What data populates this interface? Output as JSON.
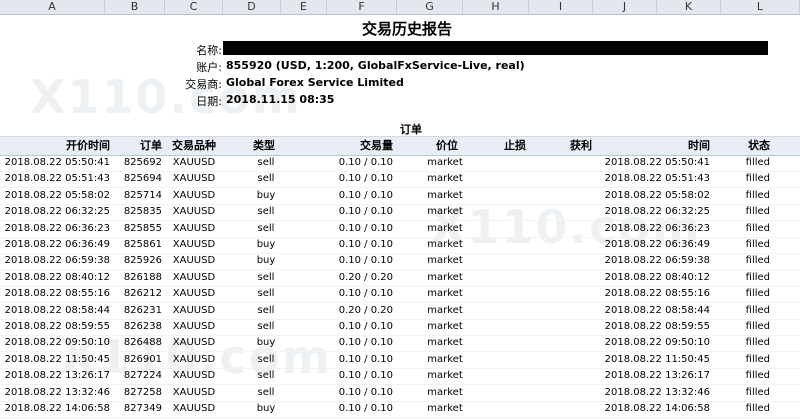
{
  "columns": [
    "A",
    "B",
    "C",
    "D",
    "E",
    "F",
    "G",
    "H",
    "I",
    "J",
    "K",
    "L"
  ],
  "report_title": "交易历史报告",
  "info": {
    "name_label": "名称:",
    "account_label": "账户:",
    "account_value": "855920 (USD, 1:200, GlobalFxService-Live, real)",
    "broker_label": "交易商:",
    "broker_value": "Global Forex Service Limited",
    "date_label": "日期:",
    "date_value": "2018.11.15 08:35"
  },
  "section_title": "订单",
  "table": {
    "headers": {
      "open_time": "开价时间",
      "order": "订单",
      "symbol": "交易品种",
      "type": "类型",
      "volume": "交易量",
      "price": "价位",
      "sl": "止损",
      "tp": "获利",
      "time": "时间",
      "state": "状态"
    },
    "rows": [
      {
        "open_time": "2018.08.22 05:50:41",
        "order": "825692",
        "symbol": "XAUUSD",
        "type": "sell",
        "volume": "0.10 / 0.10",
        "price": "market",
        "time": "2018.08.22 05:50:41",
        "state": "filled"
      },
      {
        "open_time": "2018.08.22 05:51:43",
        "order": "825694",
        "symbol": "XAUUSD",
        "type": "sell",
        "volume": "0.10 / 0.10",
        "price": "market",
        "time": "2018.08.22 05:51:43",
        "state": "filled"
      },
      {
        "open_time": "2018.08.22 05:58:02",
        "order": "825714",
        "symbol": "XAUUSD",
        "type": "buy",
        "volume": "0.10 / 0.10",
        "price": "market",
        "time": "2018.08.22 05:58:02",
        "state": "filled"
      },
      {
        "open_time": "2018.08.22 06:32:25",
        "order": "825835",
        "symbol": "XAUUSD",
        "type": "sell",
        "volume": "0.10 / 0.10",
        "price": "market",
        "time": "2018.08.22 06:32:25",
        "state": "filled"
      },
      {
        "open_time": "2018.08.22 06:36:23",
        "order": "825855",
        "symbol": "XAUUSD",
        "type": "sell",
        "volume": "0.10 / 0.10",
        "price": "market",
        "time": "2018.08.22 06:36:23",
        "state": "filled"
      },
      {
        "open_time": "2018.08.22 06:36:49",
        "order": "825861",
        "symbol": "XAUUSD",
        "type": "buy",
        "volume": "0.10 / 0.10",
        "price": "market",
        "time": "2018.08.22 06:36:49",
        "state": "filled"
      },
      {
        "open_time": "2018.08.22 06:59:38",
        "order": "825926",
        "symbol": "XAUUSD",
        "type": "buy",
        "volume": "0.10 / 0.10",
        "price": "market",
        "time": "2018.08.22 06:59:38",
        "state": "filled"
      },
      {
        "open_time": "2018.08.22 08:40:12",
        "order": "826188",
        "symbol": "XAUUSD",
        "type": "sell",
        "volume": "0.20 / 0.20",
        "price": "market",
        "time": "2018.08.22 08:40:12",
        "state": "filled"
      },
      {
        "open_time": "2018.08.22 08:55:16",
        "order": "826212",
        "symbol": "XAUUSD",
        "type": "sell",
        "volume": "0.10 / 0.10",
        "price": "market",
        "time": "2018.08.22 08:55:16",
        "state": "filled"
      },
      {
        "open_time": "2018.08.22 08:58:44",
        "order": "826231",
        "symbol": "XAUUSD",
        "type": "sell",
        "volume": "0.20 / 0.20",
        "price": "market",
        "time": "2018.08.22 08:58:44",
        "state": "filled"
      },
      {
        "open_time": "2018.08.22 08:59:55",
        "order": "826238",
        "symbol": "XAUUSD",
        "type": "sell",
        "volume": "0.10 / 0.10",
        "price": "market",
        "time": "2018.08.22 08:59:55",
        "state": "filled"
      },
      {
        "open_time": "2018.08.22 09:50:10",
        "order": "826488",
        "symbol": "XAUUSD",
        "type": "buy",
        "volume": "0.10 / 0.10",
        "price": "market",
        "time": "2018.08.22 09:50:10",
        "state": "filled"
      },
      {
        "open_time": "2018.08.22 11:50:45",
        "order": "826901",
        "symbol": "XAUUSD",
        "type": "sell",
        "volume": "0.10 / 0.10",
        "price": "market",
        "time": "2018.08.22 11:50:45",
        "state": "filled"
      },
      {
        "open_time": "2018.08.22 13:26:17",
        "order": "827224",
        "symbol": "XAUUSD",
        "type": "sell",
        "volume": "0.10 / 0.10",
        "price": "market",
        "time": "2018.08.22 13:26:17",
        "state": "filled"
      },
      {
        "open_time": "2018.08.22 13:32:46",
        "order": "827258",
        "symbol": "XAUUSD",
        "type": "sell",
        "volume": "0.10 / 0.10",
        "price": "market",
        "time": "2018.08.22 13:32:46",
        "state": "filled"
      },
      {
        "open_time": "2018.08.22 14:06:58",
        "order": "827349",
        "symbol": "XAUUSD",
        "type": "buy",
        "volume": "0.10 / 0.10",
        "price": "market",
        "time": "2018.08.22 14:06:58",
        "state": "filled"
      }
    ]
  },
  "watermark": "X110.com"
}
